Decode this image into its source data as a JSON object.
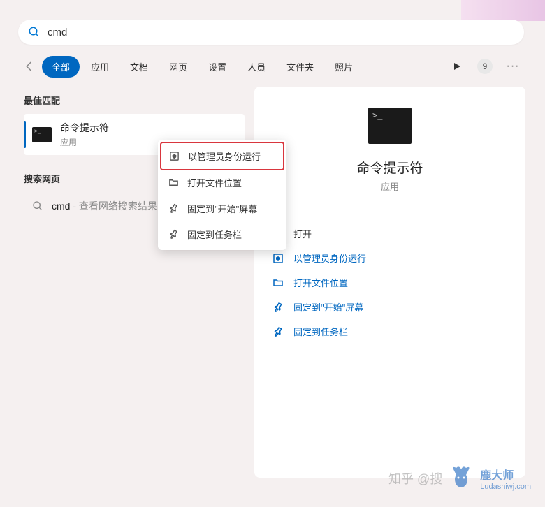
{
  "search": {
    "query": "cmd"
  },
  "filters": {
    "tabs": [
      "全部",
      "应用",
      "文档",
      "网页",
      "设置",
      "人员",
      "文件夹",
      "照片"
    ],
    "active_index": 0,
    "badge": "9"
  },
  "left": {
    "best_match_label": "最佳匹配",
    "best_match": {
      "title": "命令提示符",
      "subtitle": "应用"
    },
    "search_web_label": "搜索网页",
    "web_result": {
      "query": "cmd",
      "suffix": " - 查看网络搜索结果"
    }
  },
  "detail": {
    "title": "命令提示符",
    "type": "应用",
    "actions": [
      {
        "icon": "open",
        "label": "打开"
      },
      {
        "icon": "admin",
        "label": "以管理员身份运行"
      },
      {
        "icon": "folder",
        "label": "打开文件位置"
      },
      {
        "icon": "pin",
        "label": "固定到\"开始\"屏幕"
      },
      {
        "icon": "pin",
        "label": "固定到任务栏"
      }
    ]
  },
  "context_menu": {
    "items": [
      {
        "icon": "admin",
        "label": "以管理员身份运行",
        "highlighted": true
      },
      {
        "icon": "folder",
        "label": "打开文件位置"
      },
      {
        "icon": "pin",
        "label": "固定到\"开始\"屏幕"
      },
      {
        "icon": "pin",
        "label": "固定到任务栏"
      }
    ]
  },
  "watermark": {
    "text": "知乎 @搜",
    "brand": "鹿大师",
    "url": "Ludashiwj.com"
  }
}
